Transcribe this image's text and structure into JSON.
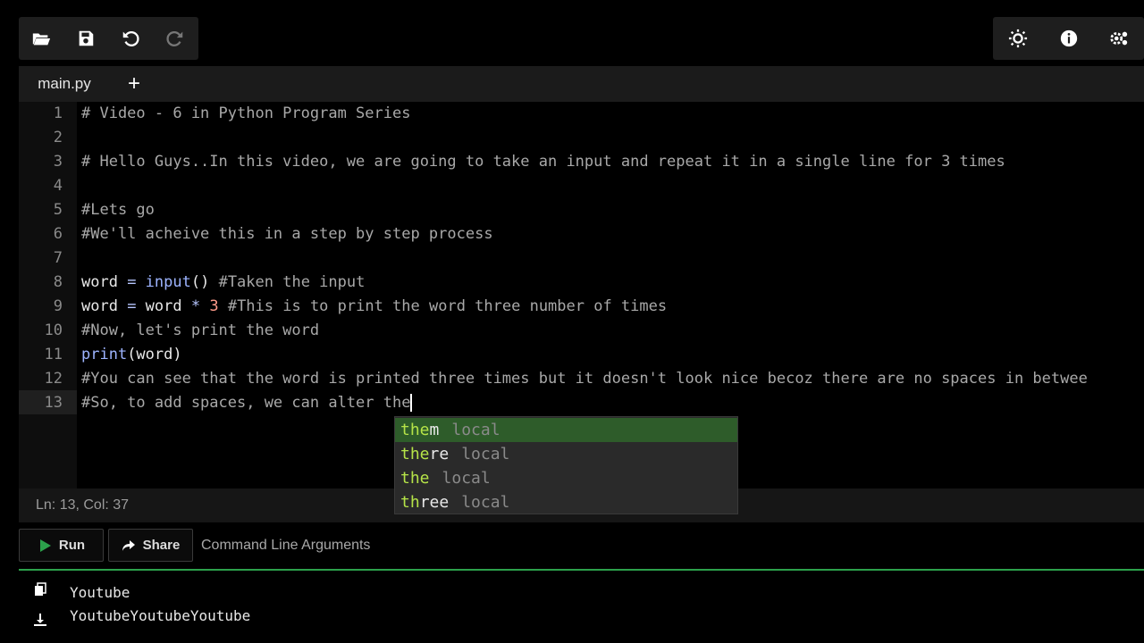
{
  "tabs": [
    {
      "label": "main.py"
    }
  ],
  "tab_add_label": "+",
  "editor": {
    "lines": [
      {
        "num": "1",
        "segments": [
          {
            "t": "# Video - 6 in Python Program Series",
            "c": "cm"
          }
        ]
      },
      {
        "num": "2",
        "segments": []
      },
      {
        "num": "3",
        "segments": [
          {
            "t": "# Hello Guys..In this video, we are going to take an input and repeat it in a single line for 3 times",
            "c": "cm"
          }
        ]
      },
      {
        "num": "4",
        "segments": []
      },
      {
        "num": "5",
        "segments": [
          {
            "t": "#Lets go",
            "c": "cm"
          }
        ]
      },
      {
        "num": "6",
        "segments": [
          {
            "t": "#We'll acheive this in a step by step process",
            "c": "cm"
          }
        ]
      },
      {
        "num": "7",
        "segments": []
      },
      {
        "num": "8",
        "segments": [
          {
            "t": "word ",
            "c": ""
          },
          {
            "t": "= ",
            "c": "op"
          },
          {
            "t": "input",
            "c": "fn"
          },
          {
            "t": "() ",
            "c": ""
          },
          {
            "t": "#Taken the input",
            "c": "cm"
          }
        ]
      },
      {
        "num": "9",
        "segments": [
          {
            "t": "word ",
            "c": ""
          },
          {
            "t": "= ",
            "c": "op"
          },
          {
            "t": "word ",
            "c": ""
          },
          {
            "t": "* ",
            "c": "op"
          },
          {
            "t": "3 ",
            "c": "num"
          },
          {
            "t": "#This is to print the word three number of times",
            "c": "cm"
          }
        ]
      },
      {
        "num": "10",
        "segments": [
          {
            "t": "#Now, let's print the word",
            "c": "cm"
          }
        ]
      },
      {
        "num": "11",
        "segments": [
          {
            "t": "print",
            "c": "fn"
          },
          {
            "t": "(word)",
            "c": ""
          }
        ]
      },
      {
        "num": "12",
        "segments": [
          {
            "t": "#You can see that the word is printed three times but it doesn't look nice becoz there are no spaces in betwee",
            "c": "cm"
          }
        ]
      },
      {
        "num": "13",
        "segments": [
          {
            "t": "#So, to add spaces, we can alter the",
            "c": "cm"
          }
        ]
      }
    ]
  },
  "status": {
    "text": "Ln: 13,  Col: 37"
  },
  "autocomplete": [
    {
      "match": "the",
      "rest": "m",
      "label": "local",
      "selected": true
    },
    {
      "match": "the",
      "rest": "re",
      "label": "local",
      "selected": false
    },
    {
      "match": "the",
      "rest": "",
      "label": "local",
      "selected": false
    },
    {
      "match": "th",
      "rest": "ree",
      "label": "local",
      "selected": false
    }
  ],
  "actions": {
    "run_label": "Run",
    "share_label": "Share",
    "cli_args_label": "Command Line Arguments"
  },
  "output": {
    "lines": [
      "Youtube",
      "YoutubeYoutubeYoutube"
    ]
  },
  "colors": {
    "accent_green": "#2ca14b",
    "selection_green": "#2e5c2a",
    "match_green": "#b5e348"
  },
  "icons": {
    "toolbar_left": [
      "folder-open-icon",
      "save-icon",
      "undo-icon",
      "redo-icon"
    ],
    "toolbar_right": [
      "sun-icon",
      "info-icon",
      "settings-icon"
    ],
    "output_side": [
      "copy-icon",
      "download-icon"
    ]
  }
}
